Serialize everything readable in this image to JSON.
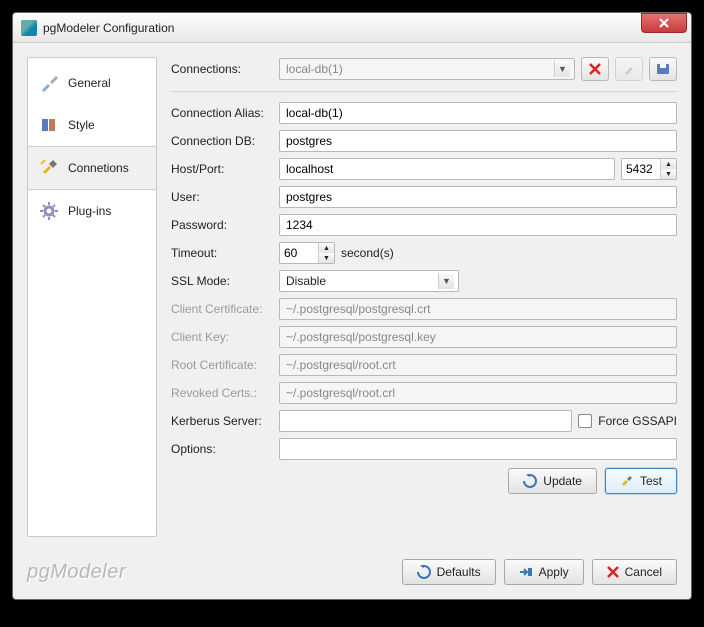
{
  "window": {
    "title": "pgModeler Configuration"
  },
  "sidebar": {
    "items": [
      {
        "label": "General"
      },
      {
        "label": "Style"
      },
      {
        "label": "Connetions"
      },
      {
        "label": "Plug-ins"
      }
    ]
  },
  "top": {
    "connections_label": "Connections:",
    "connections_value": "local-db(1)"
  },
  "fields": {
    "alias_label": "Connection Alias:",
    "alias_value": "local-db(1)",
    "db_label": "Connection DB:",
    "db_value": "postgres",
    "hostport_label": "Host/Port:",
    "host_value": "localhost",
    "port_value": "5432",
    "user_label": "User:",
    "user_value": "postgres",
    "password_label": "Password:",
    "password_value": "1234",
    "timeout_label": "Timeout:",
    "timeout_value": "60",
    "timeout_unit": "second(s)",
    "ssl_label": "SSL Mode:",
    "ssl_value": "Disable",
    "clientcert_label": "Client Certificate:",
    "clientcert_value": "~/.postgresql/postgresql.crt",
    "clientkey_label": "Client Key:",
    "clientkey_value": "~/.postgresql/postgresql.key",
    "rootcert_label": "Root Certificate:",
    "rootcert_value": "~/.postgresql/root.crt",
    "revoked_label": "Revoked Certs.:",
    "revoked_value": "~/.postgresql/root.crl",
    "kerberus_label": "Kerberus Server:",
    "kerberus_value": "",
    "force_gssapi_label": "Force GSSAPI",
    "options_label": "Options:",
    "options_value": ""
  },
  "buttons": {
    "update": "Update",
    "test": "Test",
    "defaults": "Defaults",
    "apply": "Apply",
    "cancel": "Cancel"
  },
  "branding": {
    "logo": "pgModeler"
  }
}
